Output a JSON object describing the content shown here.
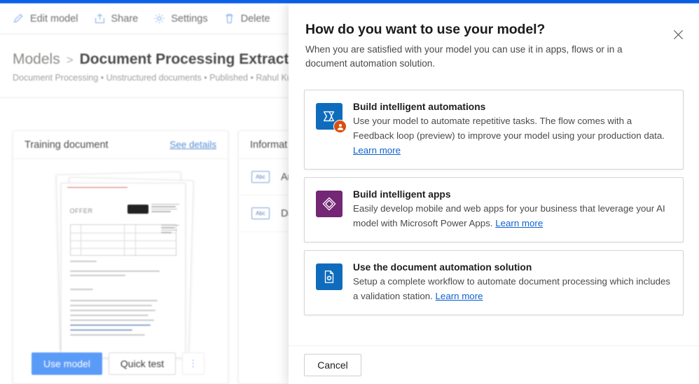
{
  "theme": {
    "accent_bar": "#0b61e8",
    "link": "#0d62d0",
    "primary_button": "#5b9bf8",
    "power_automate_tile": "#0f6cbd",
    "power_automate_badge": "#d8500f",
    "power_apps_tile": "#742774",
    "doc_automation_tile": "#0f6cbd"
  },
  "command_bar": {
    "items": [
      {
        "label": "Edit model",
        "icon": "pencil-icon"
      },
      {
        "label": "Share",
        "icon": "share-icon"
      },
      {
        "label": "Settings",
        "icon": "gear-icon"
      },
      {
        "label": "Delete",
        "icon": "trash-icon"
      }
    ]
  },
  "breadcrumb": {
    "root": "Models",
    "separator": ">",
    "title": "Document Processing Extracting Ange",
    "subtitle": "Document Processing • Unstructured documents • Published • Rahul Kum"
  },
  "training_card": {
    "title": "Training document",
    "link": "See details",
    "doc_heading": "OFFER",
    "actions": {
      "primary": "Use model",
      "secondary": "Quick test",
      "more": "⋮"
    }
  },
  "information_card": {
    "title": "Informat",
    "rows": [
      {
        "chip": "Abc",
        "label": "Ang"
      },
      {
        "chip": "Abc",
        "label": "Dat"
      }
    ]
  },
  "dialog": {
    "title": "How do you want to use your model?",
    "subtitle": "When you are satisfied with your model you can use it in apps, flows or in a document automation solution.",
    "close_icon": "close-icon",
    "options": [
      {
        "icon": "power-automate-icon",
        "title": "Build intelligent automations",
        "desc_before": "Use your model to automate repetitive tasks. The flow comes with a Feedback loop (preview) to improve your model using your production data. ",
        "link": "Learn more"
      },
      {
        "icon": "power-apps-icon",
        "title": "Build intelligent apps",
        "desc_before": "Easily develop mobile and web apps for your business that leverage your AI model with Microsoft Power Apps. ",
        "link": "Learn more"
      },
      {
        "icon": "document-automation-icon",
        "title": "Use the document automation solution",
        "desc_before": "Setup a complete workflow to automate document processing which includes a validation station. ",
        "link": "Learn more"
      }
    ],
    "cancel_label": "Cancel"
  }
}
